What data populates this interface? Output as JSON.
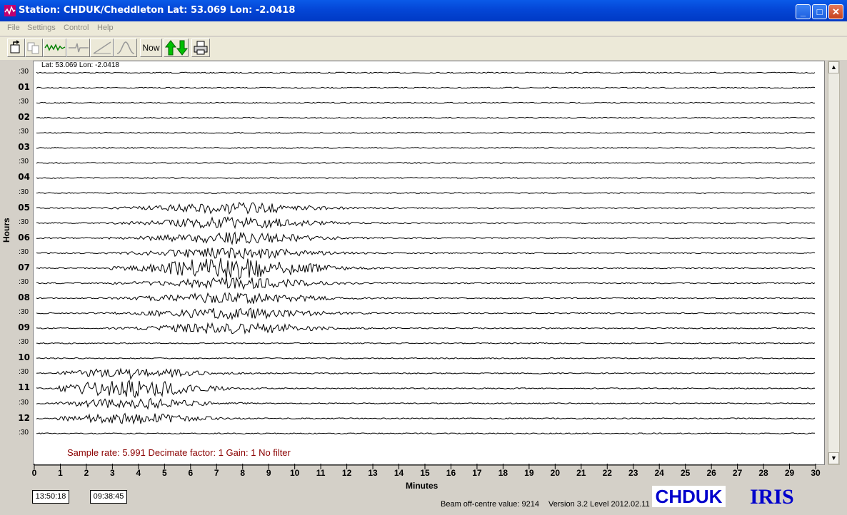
{
  "window": {
    "title": "Station: CHDUK/Cheddleton Lat: 53.069 Lon: -2.0418"
  },
  "menu": [
    "File",
    "Settings",
    "Control",
    "Help"
  ],
  "toolbar": {
    "now_label": "Now"
  },
  "plot": {
    "latlon": "Lat: 53.069 Lon: -2.0418",
    "hours_label": "Hours",
    "minutes_label": "Minutes",
    "hour_labels": [
      "01",
      "02",
      "03",
      "04",
      "05",
      "06",
      "07",
      "08",
      "09",
      "10",
      "11",
      "12"
    ],
    "half_label": ":30",
    "minute_ticks": [
      "0",
      "1",
      "2",
      "3",
      "4",
      "5",
      "6",
      "7",
      "8",
      "9",
      "10",
      "11",
      "12",
      "13",
      "14",
      "15",
      "16",
      "17",
      "18",
      "19",
      "20",
      "21",
      "22",
      "23",
      "24",
      "25",
      "26",
      "27",
      "28",
      "29",
      "30"
    ],
    "info": "Sample rate: 5.991  Decimate factor: 1  Gain: 1  No filter"
  },
  "footer": {
    "time_left": "13:50:18",
    "time_right": "09:38:45",
    "beam": "Beam off-centre value: 9214",
    "version": "Version 3.2 Level 2012.02.11",
    "logo_station": "CHDUK",
    "logo_iris": "IRIS"
  },
  "colors": {
    "title_bar": "#0446d6",
    "trace": "#000000",
    "info_text": "#8b0000",
    "logo": "#0000cc"
  }
}
